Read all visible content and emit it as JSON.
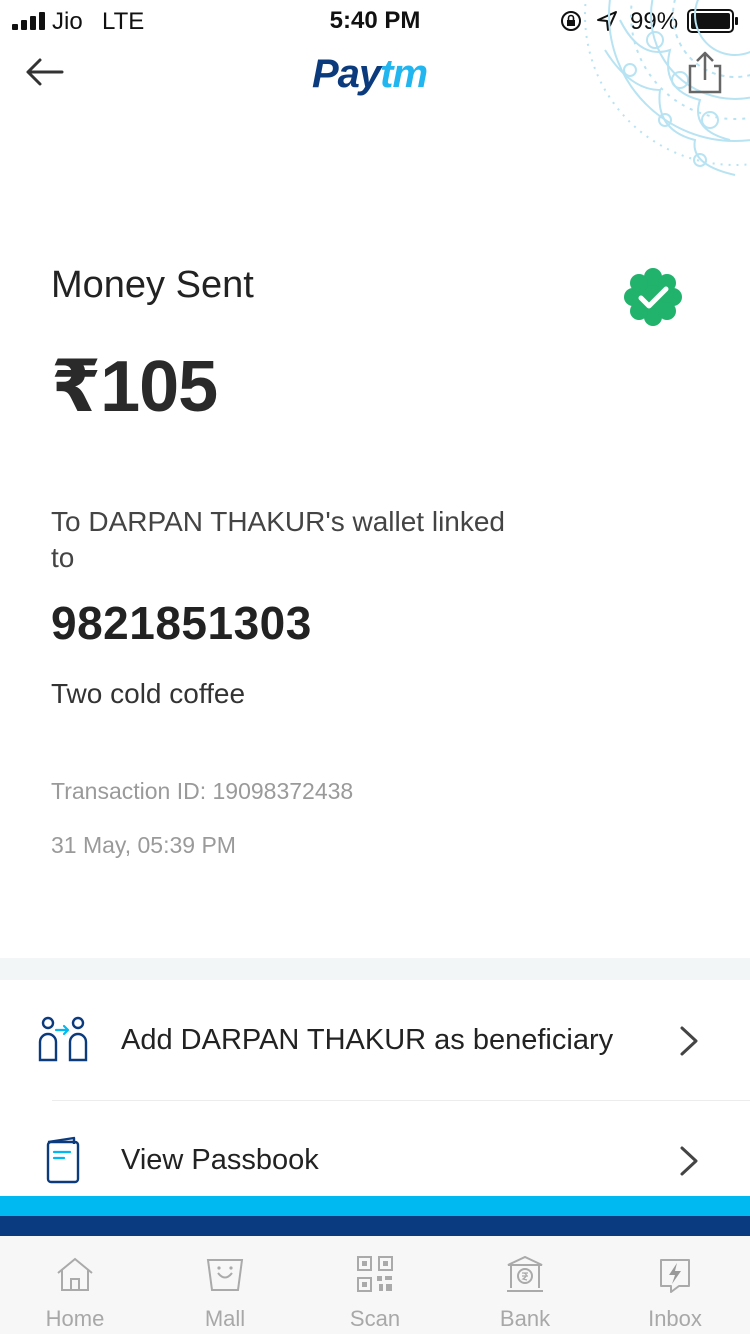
{
  "status_bar": {
    "carrier": "Jio",
    "network": "LTE",
    "time": "5:40 PM",
    "battery_percent": "99%"
  },
  "header": {
    "logo_pay": "Pay",
    "logo_tm": "tm",
    "back_icon": "arrow-left-icon",
    "share_icon": "share-icon"
  },
  "transaction": {
    "title": "Money Sent",
    "amount": "₹105",
    "recipient_line": "To DARPAN THAKUR's wallet linked to",
    "phone": "9821851303",
    "note": "Two cold coffee",
    "transaction_id": "Transaction ID: 19098372438",
    "datetime": "31 May, 05:39 PM",
    "status_color": "#21b26b"
  },
  "actions": [
    {
      "label": "Add DARPAN THAKUR as beneficiary",
      "icon": "beneficiary-icon"
    },
    {
      "label": "View Passbook",
      "icon": "passbook-icon"
    }
  ],
  "tab_bar": {
    "tabs": [
      {
        "label": "Home",
        "icon": "home-icon"
      },
      {
        "label": "Mall",
        "icon": "mall-icon"
      },
      {
        "label": "Scan",
        "icon": "qr-scan-icon"
      },
      {
        "label": "Bank",
        "icon": "bank-icon"
      },
      {
        "label": "Inbox",
        "icon": "inbox-icon"
      }
    ]
  },
  "colors": {
    "brand_dark": "#0c3b7d",
    "brand_light": "#00b9f1",
    "success": "#21b26b"
  }
}
